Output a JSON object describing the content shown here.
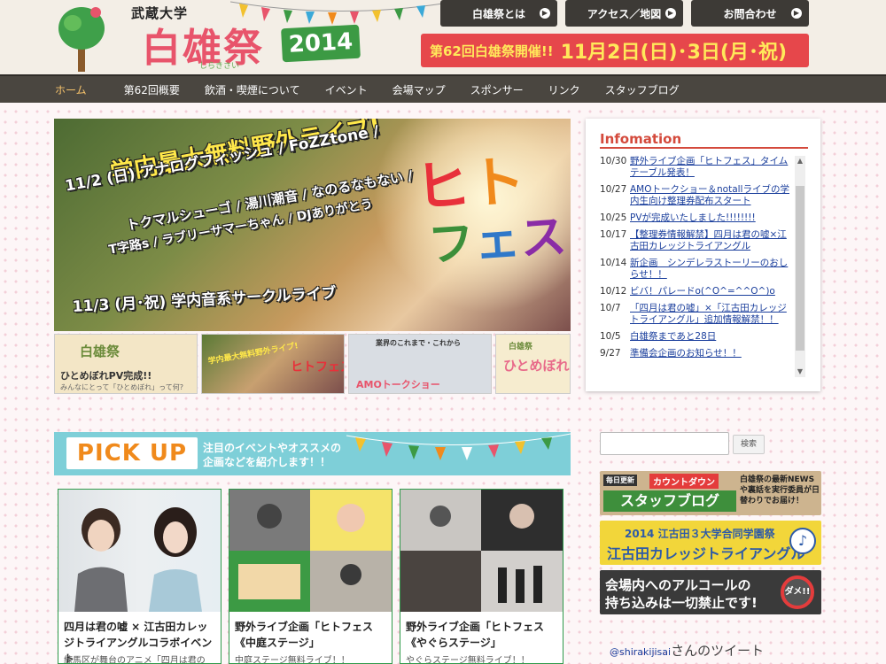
{
  "header": {
    "subtitle": "武蔵大学",
    "brand": "白雄祭",
    "brand_ruby": "しらきさい",
    "year": "2014",
    "top_nav": [
      {
        "label": "白雄祭とは"
      },
      {
        "label": "アクセス／地図"
      },
      {
        "label": "お問合わせ"
      }
    ],
    "announce_prefix": "第62回白雄祭開催!!",
    "announce_date": "11月2日(日)･3日(月･祝)"
  },
  "nav": {
    "items": [
      "ホーム",
      "第62回概要",
      "飲酒・喫煙について",
      "イベント",
      "会場マップ",
      "スポンサー",
      "リンク",
      "スタッフブログ"
    ]
  },
  "hero": {
    "headline": "学内最大無料野外ライブ!",
    "day1": "11/2 (日) アナログフィッシュ / FoZZtone /",
    "artists1": "トクマルシューゴ / 湯川潮音 / なのるなもない /",
    "artists2": "T字路s / ラブリーサマーちゃん / DJありがとう",
    "day2": "11/3 (月･祝) 学内音系サークルライブ",
    "logo_line1_a": "ヒ",
    "logo_line1_b": "ト",
    "logo_line2_a": "フ",
    "logo_line2_b": "ェ",
    "logo_line2_c": "ス"
  },
  "thumbs": [
    {
      "t1": "白雄祭",
      "t2": "ひとめぼれPV完成!!",
      "t3": "みんなにとって「ひとめぼれ」って何?"
    },
    {
      "t1": "学内最大無料野外ライブ!",
      "t2": "ヒトフェス"
    },
    {
      "t1": "業界のこれまで・これから",
      "t2": "AMOトークショー"
    },
    {
      "t1": "白雄祭",
      "t2": "ひとめぼれ"
    }
  ],
  "info": {
    "title": "Infomation",
    "items": [
      {
        "date": "10/30",
        "text": "野外ライブ企画「ヒトフェス」タイムテーブル発表！"
      },
      {
        "date": "10/27",
        "text": "AMOトークショー＆notallライブの学内生向け整理券配布スタート"
      },
      {
        "date": "10/25",
        "text": "PVが完成いたしました!!!!!!!!"
      },
      {
        "date": "10/17",
        "text": "【整理券情報解禁】四月は君の嘘×江古田カレッジトライアングル"
      },
      {
        "date": "10/14",
        "text": "新企画　シンデレラストーリーのおしらせ！！"
      },
      {
        "date": "10/12",
        "text": "ビバ！パレードo(^O^=^^O^)o"
      },
      {
        "date": "10/7",
        "text": "「四月は君の嘘」×「江古田カレッジトライアングル」追加情報解禁！！"
      },
      {
        "date": "10/5",
        "text": "白雄祭まであと28日"
      },
      {
        "date": "9/27",
        "text": "準備会企画のお知らせ！！"
      }
    ]
  },
  "pickup": {
    "label": "PICK UP",
    "desc1": "注目のイベントやオススメの",
    "desc2": "企画などを紹介します！！"
  },
  "cards": [
    {
      "title": "四月は君の嘘 × 江古田カレッジトライアングルコラボイベント",
      "sub": "練馬区が舞台のアニメ「四月は君の"
    },
    {
      "title": "野外ライブ企画「ヒトフェス《中庭ステージ」",
      "sub": "中庭ステージ無料ライブ！！"
    },
    {
      "title": "野外ライブ企画「ヒトフェス《やぐらステージ」",
      "sub": "やぐらステージ無料ライブ！！"
    }
  ],
  "sidebar": {
    "search_button": "検索",
    "blog_tag": "毎日更新",
    "blog_countdown": "カウントダウン",
    "blog_title": "スタッフブログ",
    "blog_note": "白雄祭の最新NEWSや裏話を実行委員が日替わりでお届け！",
    "egota_line1": "2014 江古田３大学合同学園祭",
    "egota_line2": "江古田カレッジトライアングル",
    "alcohol_line1": "会場内へのアルコールの",
    "alcohol_line2": "持ち込みは一切禁止です!",
    "alcohol_badge": "ダメ!!",
    "tweet_handle": "@shirakijisai",
    "tweet_suffix": "さんのツイート"
  },
  "colors": {
    "accent_red": "#e6474b",
    "nav_bg": "#4a4640",
    "nav_active": "#f7c36b",
    "pickup_bg": "#7ecfd8",
    "card_border": "#2e9a4a"
  }
}
